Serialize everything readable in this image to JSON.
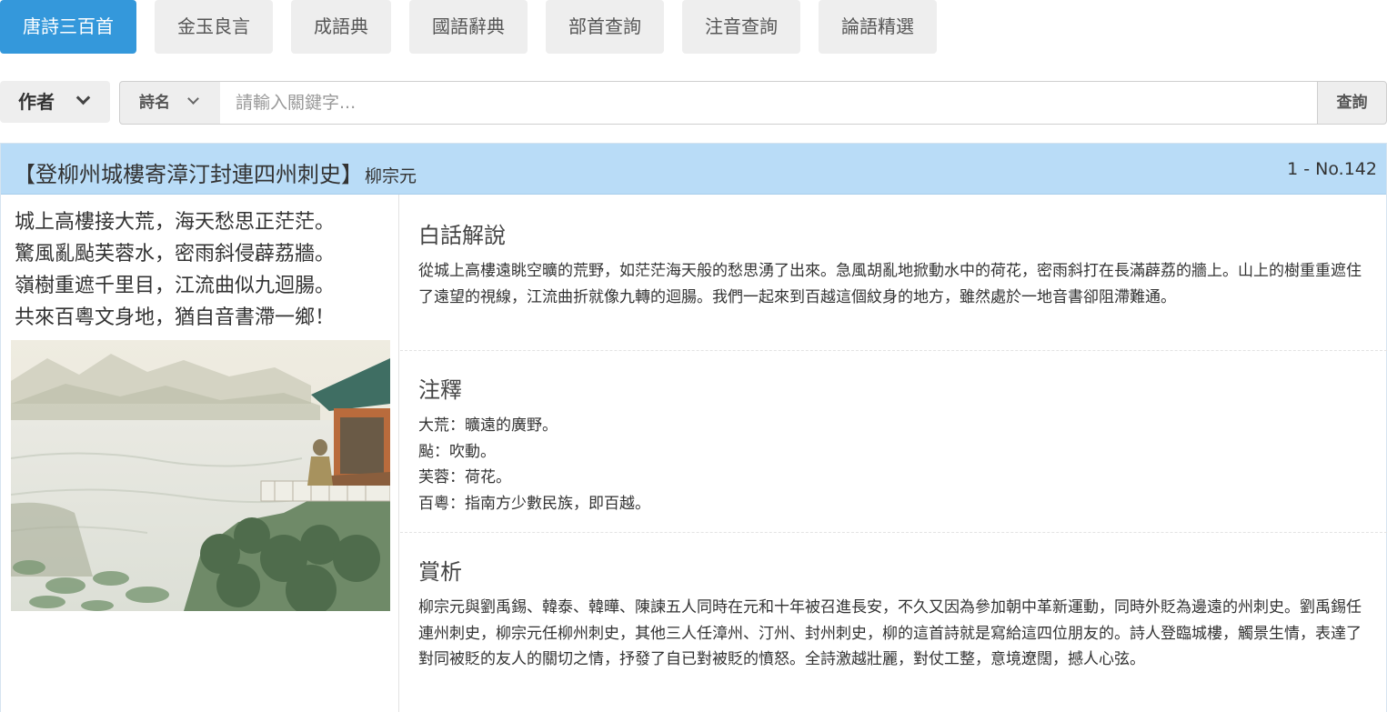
{
  "tabs": [
    {
      "label": "唐詩三百首",
      "active": true
    },
    {
      "label": "金玉良言",
      "active": false
    },
    {
      "label": "成語典",
      "active": false
    },
    {
      "label": "國語辭典",
      "active": false
    },
    {
      "label": "部首查詢",
      "active": false
    },
    {
      "label": "注音查詢",
      "active": false
    },
    {
      "label": "論語精選",
      "active": false
    }
  ],
  "search": {
    "author_label": "作者",
    "field_label": "詩名",
    "placeholder": "請輸入關鍵字...",
    "query_label": "查詢"
  },
  "poem": {
    "title": "【登柳州城樓寄漳汀封連四州刺史】",
    "author": "柳宗元",
    "number": "1 - No.142",
    "lines": [
      "城上高樓接大荒，海天愁思正茫茫。",
      "驚風亂颭芙蓉水，密雨斜侵薜荔牆。",
      "嶺樹重遮千里目，江流曲似九迴腸。",
      "共來百粵文身地，猶自音書滯一鄉！"
    ]
  },
  "sections": {
    "translation": {
      "title": "白話解說",
      "body": "從城上高樓遠眺空曠的荒野，如茫茫海天般的愁思湧了出來。急風胡亂地掀動水中的荷花，密雨斜打在長滿薜荔的牆上。山上的樹重重遮住了遠望的視線，江流曲折就像九轉的迴腸。我們一起來到百越這個紋身的地方，雖然處於一地音書卻阻滯難通。"
    },
    "notes": {
      "title": "注釋",
      "items": [
        "大荒：曠遠的廣野。",
        "颭：吹動。",
        "芙蓉：荷花。",
        "百粵：指南方少數民族，即百越。"
      ]
    },
    "appreciation": {
      "title": "賞析",
      "body": "柳宗元與劉禹錫、韓泰、韓曄、陳諫五人同時在元和十年被召進長安，不久又因為參加朝中革新運動，同時外貶為邊遠的州刺史。劉禹錫任連州刺史，柳宗元任柳州刺史，其他三人任漳州、汀州、封州刺史，柳的這首詩就是寫給這四位朋友的。詩人登臨城樓，觸景生情，表達了對同被貶的友人的關切之情，抒發了自已對被貶的憤怒。全詩激越壯麗，對仗工整，意境遼闊，撼人心弦。"
    }
  },
  "colors": {
    "tab_active": "#3498db",
    "panel_header": "#b9dcf7"
  }
}
